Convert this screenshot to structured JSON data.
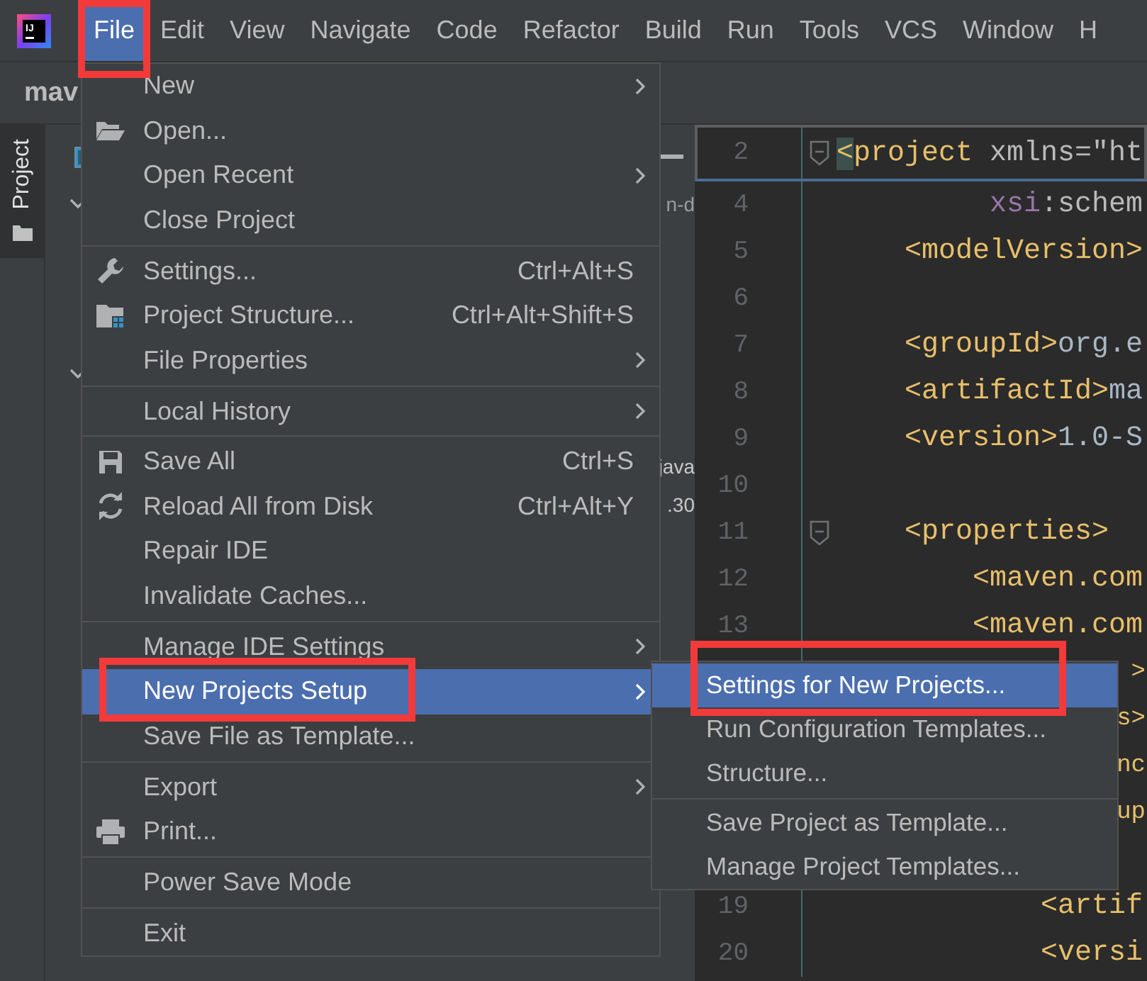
{
  "menubar": {
    "logo": "IJ",
    "items": [
      {
        "label": "File",
        "selected": true,
        "highlighted": true
      },
      {
        "label": "Edit",
        "selected": false,
        "highlighted": false
      },
      {
        "label": "View",
        "selected": false,
        "highlighted": false
      },
      {
        "label": "Navigate",
        "selected": false,
        "highlighted": false
      },
      {
        "label": "Code",
        "selected": false,
        "highlighted": false
      },
      {
        "label": "Refactor",
        "selected": false,
        "highlighted": false
      },
      {
        "label": "Build",
        "selected": false,
        "highlighted": false
      },
      {
        "label": "Run",
        "selected": false,
        "highlighted": false
      },
      {
        "label": "Tools",
        "selected": false,
        "highlighted": false
      },
      {
        "label": "VCS",
        "selected": false,
        "highlighted": false
      },
      {
        "label": "Window",
        "selected": false,
        "highlighted": false
      },
      {
        "label": "H",
        "selected": false,
        "highlighted": false
      }
    ]
  },
  "toolbar": {
    "project": "mav"
  },
  "tool_window_tab": {
    "label": "Project",
    "selected": true
  },
  "project_panel": {
    "rows": [
      {
        "kind": "root"
      },
      {
        "kind": "node",
        "expanded": true,
        "text": "n-d"
      },
      {
        "kind": "node",
        "expanded": true
      },
      {
        "kind": "leaf",
        "text": "java"
      },
      {
        "kind": "leaf",
        "text": ".30"
      }
    ]
  },
  "editor": {
    "header": {
      "number": "2",
      "fold": true,
      "segments": [
        {
          "kind": "match",
          "text": "<"
        },
        {
          "kind": "tag",
          "text": "project"
        },
        {
          "kind": "attr",
          "text": " xmlns=\"ht"
        }
      ]
    },
    "lines": [
      {
        "kind": "full",
        "number": "4",
        "fold": false,
        "segments": [
          {
            "kind": "ns",
            "text": "         xsi"
          },
          {
            "kind": "attr",
            "text": ":schem"
          }
        ]
      },
      {
        "kind": "full",
        "number": "5",
        "fold": false,
        "segments": [
          {
            "kind": "tag",
            "text": "    <modelVersion>"
          }
        ]
      },
      {
        "kind": "full",
        "number": "6",
        "fold": false
      },
      {
        "kind": "full",
        "number": "7",
        "fold": false,
        "segments": [
          {
            "kind": "tag",
            "text": "    <groupId>"
          },
          {
            "kind": "text",
            "text": "org.e"
          }
        ]
      },
      {
        "kind": "full",
        "number": "8",
        "fold": false,
        "segments": [
          {
            "kind": "tag",
            "text": "    <artifactId>"
          },
          {
            "kind": "text",
            "text": "ma"
          }
        ]
      },
      {
        "kind": "full",
        "number": "9",
        "fold": false,
        "segments": [
          {
            "kind": "tag",
            "text": "    <version>"
          },
          {
            "kind": "text",
            "text": "1.0-S"
          }
        ]
      },
      {
        "kind": "full",
        "number": "10",
        "fold": false
      },
      {
        "kind": "full",
        "number": "11",
        "fold": true,
        "segments": [
          {
            "kind": "tag",
            "text": "    <properties>"
          }
        ]
      },
      {
        "kind": "full",
        "number": "12",
        "fold": false,
        "segments": [
          {
            "kind": "tag",
            "text": "        <maven.com"
          }
        ]
      },
      {
        "kind": "full",
        "number": "13",
        "fold": false,
        "segments": [
          {
            "kind": "tag",
            "text": "        <maven.com"
          }
        ]
      },
      {
        "kind": "covered",
        "segments": [
          {
            "kind": "tag",
            "text": ">"
          }
        ]
      },
      {
        "kind": "covered",
        "segments": [
          {
            "kind": "tag",
            "text": "s>"
          }
        ]
      },
      {
        "kind": "covered",
        "segments": [
          {
            "kind": "tag",
            "text": "nc"
          }
        ]
      },
      {
        "kind": "covered",
        "segments": [
          {
            "kind": "tag",
            "text": "up"
          }
        ]
      },
      {
        "kind": "covered"
      },
      {
        "kind": "full",
        "number": "19",
        "fold": false,
        "segments": [
          {
            "kind": "tag",
            "text": "            <artif"
          }
        ]
      },
      {
        "kind": "full",
        "number": "20",
        "fold": false,
        "segments": [
          {
            "kind": "tag",
            "text": "            <versi"
          }
        ]
      }
    ]
  },
  "file_menu": {
    "groups": [
      {
        "items": [
          {
            "label": "New",
            "kind": "plain",
            "submenu": true,
            "selected": false,
            "highlighted": false
          },
          {
            "label": "Open...",
            "kind": "folder",
            "submenu": false,
            "selected": false,
            "highlighted": false
          },
          {
            "label": "Open Recent",
            "kind": "plain",
            "submenu": true,
            "selected": false,
            "highlighted": false
          },
          {
            "label": "Close Project",
            "kind": "plain",
            "submenu": false,
            "selected": false,
            "highlighted": false
          }
        ]
      },
      {
        "items": [
          {
            "label": "Settings...",
            "kind": "wrench",
            "shortcut": "Ctrl+Alt+S",
            "submenu": false,
            "selected": false,
            "highlighted": false
          },
          {
            "label": "Project Structure...",
            "kind": "structure",
            "shortcut": "Ctrl+Alt+Shift+S",
            "submenu": false,
            "selected": false,
            "highlighted": false
          },
          {
            "label": "File Properties",
            "kind": "plain",
            "submenu": true,
            "selected": false,
            "highlighted": false
          }
        ]
      },
      {
        "items": [
          {
            "label": "Local History",
            "kind": "plain",
            "submenu": true,
            "selected": false,
            "highlighted": false
          }
        ]
      },
      {
        "items": [
          {
            "label": "Save All",
            "kind": "disk",
            "shortcut": "Ctrl+S",
            "submenu": false,
            "selected": false,
            "highlighted": false
          },
          {
            "label": "Reload All from Disk",
            "kind": "reload",
            "shortcut": "Ctrl+Alt+Y",
            "submenu": false,
            "selected": false,
            "highlighted": false
          },
          {
            "label": "Repair IDE",
            "kind": "plain",
            "submenu": false,
            "selected": false,
            "highlighted": false
          },
          {
            "label": "Invalidate Caches...",
            "kind": "plain",
            "submenu": false,
            "selected": false,
            "highlighted": false
          }
        ]
      },
      {
        "items": [
          {
            "label": "Manage IDE Settings",
            "kind": "plain",
            "submenu": true,
            "selected": false,
            "highlighted": false
          },
          {
            "label": "New Projects Setup",
            "kind": "plain",
            "submenu": true,
            "selected": true,
            "highlighted": true
          },
          {
            "label": "Save File as Template...",
            "kind": "plain",
            "submenu": false,
            "selected": false,
            "highlighted": false
          }
        ]
      },
      {
        "items": [
          {
            "label": "Export",
            "kind": "plain",
            "submenu": true,
            "selected": false,
            "highlighted": false
          },
          {
            "label": "Print...",
            "kind": "printer",
            "submenu": false,
            "selected": false,
            "highlighted": false
          }
        ]
      },
      {
        "items": [
          {
            "label": "Power Save Mode",
            "kind": "plain",
            "submenu": false,
            "selected": false,
            "highlighted": false
          }
        ]
      },
      {
        "items": [
          {
            "label": "Exit",
            "kind": "plain",
            "submenu": false,
            "selected": false,
            "highlighted": false
          }
        ]
      }
    ]
  },
  "submenu": {
    "groups": [
      {
        "items": [
          {
            "label": "Settings for New Projects...",
            "selected": true,
            "highlighted": true
          },
          {
            "label": "Run Configuration Templates...",
            "selected": false,
            "highlighted": false
          },
          {
            "label": "Structure...",
            "selected": false,
            "highlighted": false
          }
        ]
      },
      {
        "items": [
          {
            "label": "Save Project as Template...",
            "selected": false,
            "highlighted": false
          },
          {
            "label": "Manage Project Templates...",
            "selected": false,
            "highlighted": false
          }
        ]
      }
    ]
  }
}
